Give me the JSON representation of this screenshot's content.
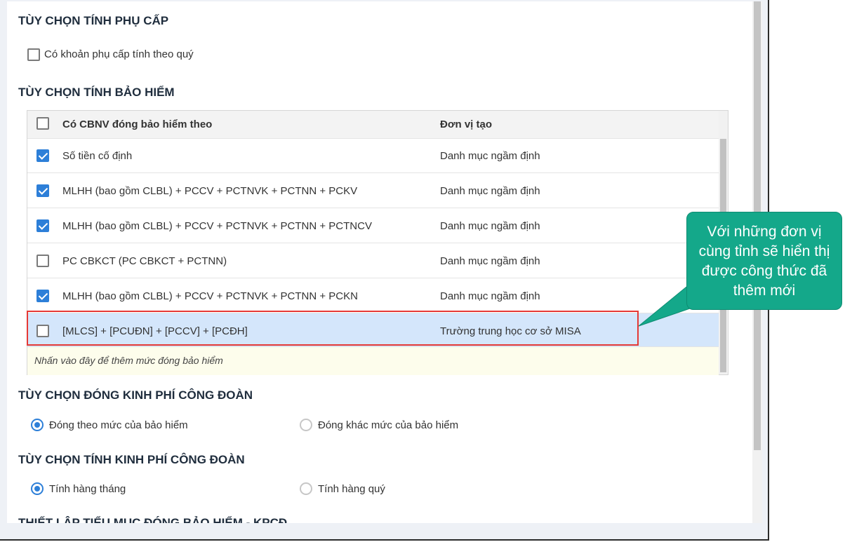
{
  "sections": {
    "allowance_title": "TÙY CHỌN TÍNH PHỤ CẤP",
    "allowance_option_label": "Có khoản phụ cấp tính theo quý",
    "insurance_title": "TÙY CHỌN TÍNH BẢO HIỂM",
    "union_fee_pay_title": "TÙY CHỌN ĐÓNG KINH PHÍ CÔNG ĐOÀN",
    "union_fee_calc_title": "TÙY CHỌN TÍNH KINH PHÍ CÔNG ĐOÀN",
    "cutoff_title": "THIẾT LẬP TIỂU MỤC ĐÓNG BẢO HIỂM - KPCĐ"
  },
  "insurance_table": {
    "headers": [
      "Có CBNV đóng bảo hiểm theo",
      "Đơn vị tạo"
    ],
    "rows": [
      {
        "formula": "Số tiền cố định",
        "creator": "Danh mục ngầm định",
        "checked": true
      },
      {
        "formula": "MLHH (bao gồm CLBL) + PCCV + PCTNVK + PCTNN + PCKV",
        "creator": "Danh mục ngầm định",
        "checked": true
      },
      {
        "formula": "MLHH (bao gồm CLBL) + PCCV + PCTNVK + PCTNN + PCTNCV",
        "creator": "Danh mục ngầm định",
        "checked": true
      },
      {
        "formula": "PC CBKCT (PC CBKCT + PCTNN)",
        "creator": "Danh mục ngầm định",
        "checked": false
      },
      {
        "formula": "MLHH (bao gồm CLBL) + PCCV + PCTNVK + PCTNN + PCKN",
        "creator": "Danh mục ngầm định",
        "checked": true
      },
      {
        "formula": "[MLCS] + [PCUĐN] + [PCCV] + [PCĐH]",
        "creator": "Trường trung học cơ sở MISA",
        "checked": false
      }
    ],
    "add_row_hint": "Nhấn vào đây để thêm mức đóng bảo hiểm"
  },
  "union_fee_pay": {
    "option_1": "Đóng theo mức của bảo hiểm",
    "option_2": "Đóng khác mức của bảo hiểm",
    "selected": "option_1"
  },
  "union_fee_calc": {
    "option_1": "Tính hàng tháng",
    "option_2": "Tính hàng quý",
    "selected": "option_1"
  },
  "callout": {
    "text": "Với những đơn vị cùng tỉnh sẽ hiển thị được công thức đã thêm mới"
  },
  "colors": {
    "accent": "#2d7fd8",
    "highlight_border": "#e53935",
    "callout_bg": "#14a88a",
    "selected_row": "#d4e6fb"
  }
}
